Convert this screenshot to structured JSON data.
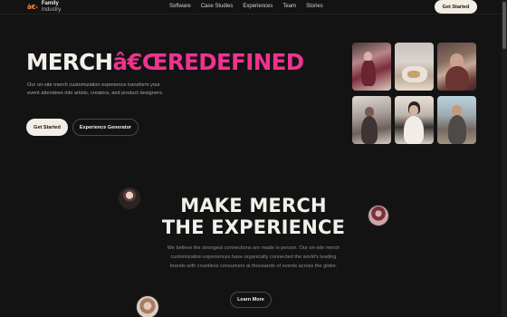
{
  "header": {
    "logo_mark": "â€‹",
    "logo_line1": "Family",
    "logo_line2": "Industry",
    "nav": [
      "Software",
      "Case Studies",
      "Experiences",
      "Team",
      "Stories"
    ],
    "cta_label": "Get Started"
  },
  "hero": {
    "title_white": "MERCH",
    "title_pink": "â€ŒREDEFINED",
    "description": "Our on-site merch customization experience transform your event attendees into artists, creators, and product designers.",
    "primary_label": "Get Started",
    "secondary_label": "Experience Generator",
    "photo_icons": [
      "photo-event-1-icon",
      "photo-event-2-icon",
      "photo-event-3-icon",
      "photo-event-4-icon",
      "photo-event-5-icon",
      "photo-event-6-icon"
    ]
  },
  "section": {
    "title_line1": "MAKE MERCH",
    "title_line2": "THE EXPERIENCE",
    "description": "We believe the strongest connections are made in person. Our on-site merch customization experiences have organically connected the world's leading brands with countless consumers at thousands of events across the globe.",
    "button_label": "Learn More"
  },
  "colors": {
    "background": "#141314",
    "accent_pink": "#f0338e",
    "cream": "#f3ede3",
    "logo_orange": "#ff8a3d"
  }
}
